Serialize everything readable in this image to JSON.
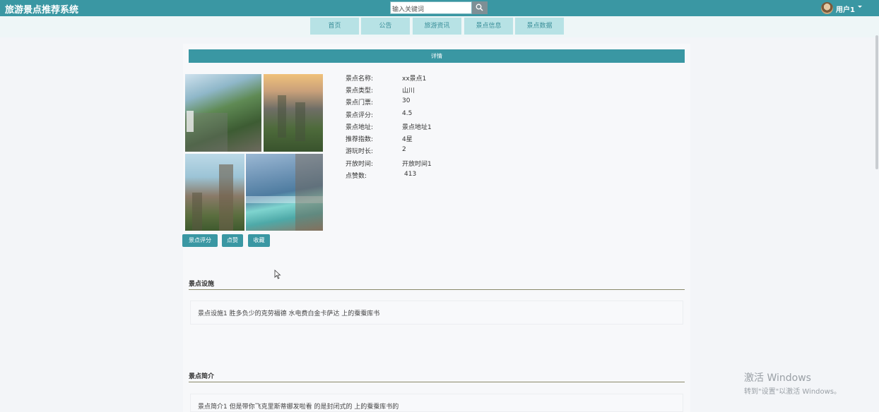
{
  "header": {
    "app_title": "旅游景点推荐系统",
    "search_placeholder": "输入关键词",
    "user_name": "用户1"
  },
  "nav": {
    "items": [
      "首页",
      "公告",
      "旅游资讯",
      "景点信息",
      "景点数据"
    ]
  },
  "detail": {
    "bar_title": "详情",
    "fields": [
      {
        "label": "景点名称:",
        "value": "xx景点1"
      },
      {
        "label": "景点类型:",
        "value": "山川"
      },
      {
        "label": "景点门票:",
        "value": "30"
      },
      {
        "label": "景点评分:",
        "value": "4.5"
      },
      {
        "label": "景点地址:",
        "value": "景点地址1"
      },
      {
        "label": "推荐指数:",
        "value": "4星"
      },
      {
        "label": "游玩时长:",
        "value": "2"
      },
      {
        "label": "开放时间:",
        "value": "开放时间1"
      },
      {
        "label": "点赞数:",
        "value": "413"
      }
    ],
    "buttons": {
      "rate": "景点评分",
      "like": "点赞",
      "favorite": "收藏"
    }
  },
  "sections": {
    "facilities": {
      "title": "景点设施",
      "content": "景点设施1 胜多负少的克劳福德 水电费白金卡萨达 上的蚕蚕库书"
    },
    "intro": {
      "title": "景点简介",
      "content": "景点简介1 但是带你飞克里斯蒂娜发啦看 的是封闭式的 上的蚕蚕库书的"
    }
  },
  "watermark": {
    "title": "激活 Windows",
    "subtitle": "转到\"设置\"以激活 Windows。"
  },
  "colors": {
    "primary": "#3a97a3",
    "nav_item_bg": "#b7e2e5",
    "page_bg": "#f3f5f8"
  }
}
